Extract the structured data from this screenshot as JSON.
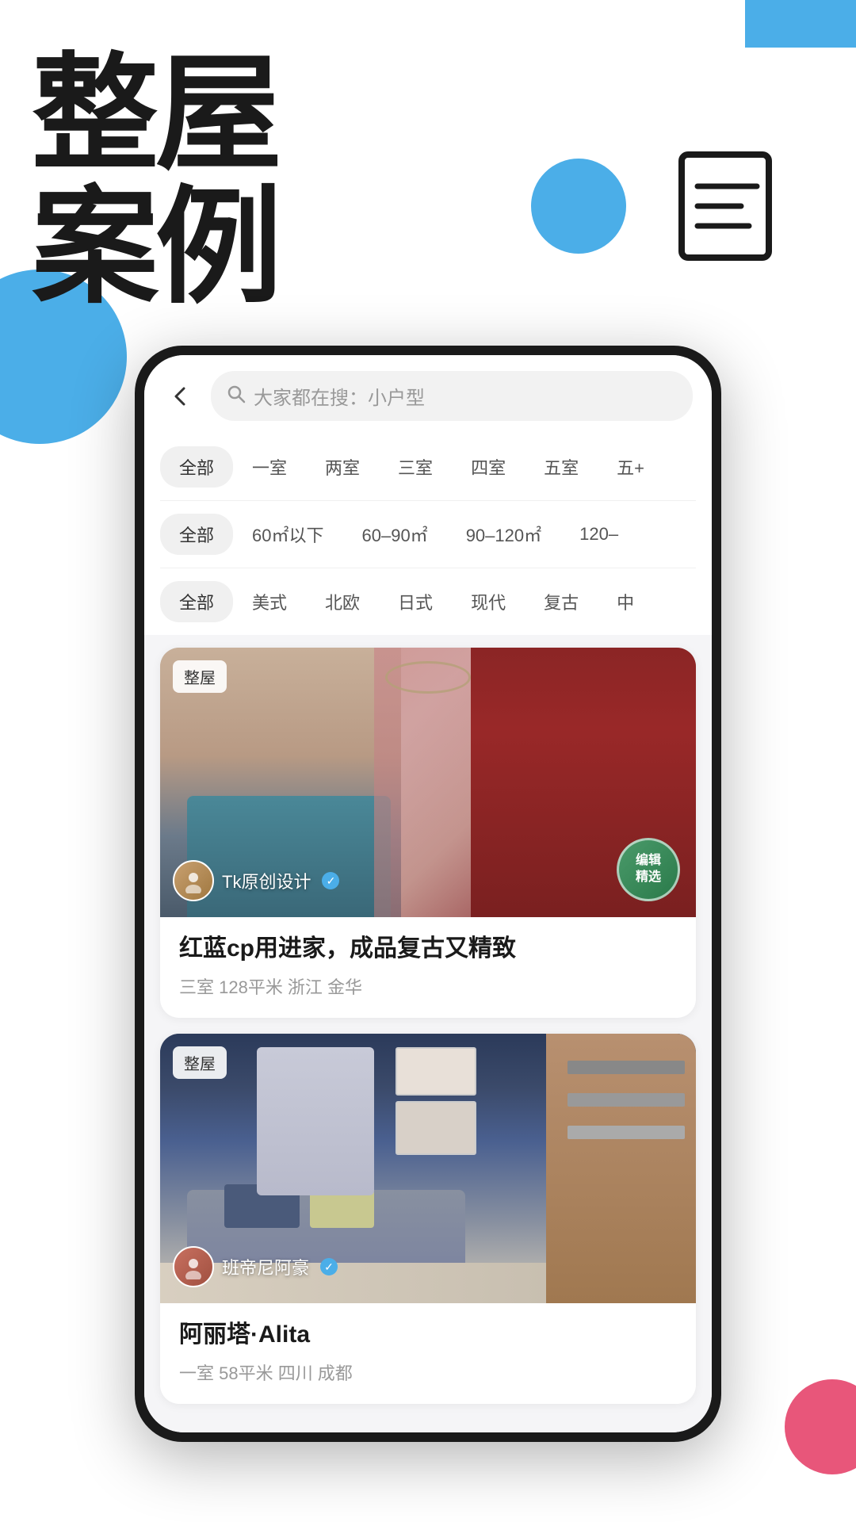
{
  "page": {
    "background": {
      "top_right_rect_color": "#4BAEE8",
      "left_circle_color": "#4BAEE8",
      "top_circle_color": "#4BAEE8",
      "bottom_pink_circle_color": "#E8567A"
    },
    "hero": {
      "line1": "整屋",
      "line2": "案例"
    },
    "search": {
      "back_label": "‹",
      "placeholder": "大家都在搜：小户型",
      "search_icon": "🔍"
    },
    "filters": {
      "row1": {
        "active": "全部",
        "items": [
          "全部",
          "一室",
          "两室",
          "三室",
          "四室",
          "五室",
          "五+"
        ]
      },
      "row2": {
        "active": "全部",
        "items": [
          "全部",
          "60㎡以下",
          "60-90㎡",
          "90-120㎡",
          "120-"
        ]
      },
      "row3": {
        "active": "全部",
        "items": [
          "全部",
          "美式",
          "北欧",
          "日式",
          "现代",
          "复古",
          "中"
        ]
      }
    },
    "cards": [
      {
        "badge": "整屋",
        "editor_pick_line1": "编辑",
        "editor_pick_line2": "精选",
        "designer_name": "Tk原创设计",
        "title": "红蓝cp用进家，成品复古又精致",
        "meta": "三室  128平米  浙江 金华",
        "has_editor_pick": true
      },
      {
        "badge": "整屋",
        "designer_name": "班帝尼阿豪",
        "title": "阿丽塔·Alita",
        "meta": "一室  58平米  四川 成都",
        "has_editor_pick": false
      }
    ]
  }
}
